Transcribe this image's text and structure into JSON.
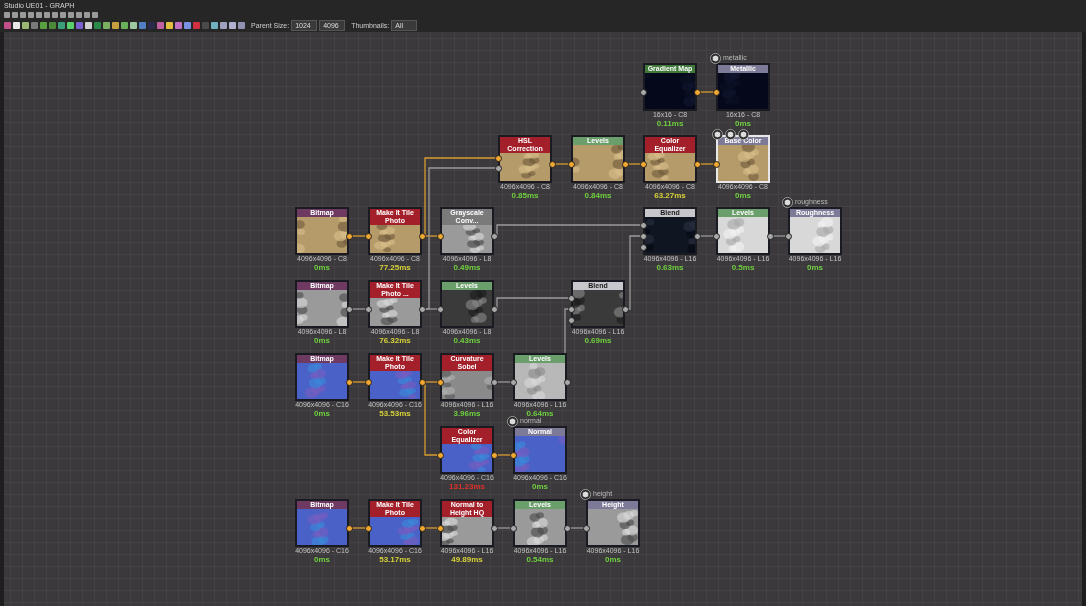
{
  "window": {
    "title": "Studio UE01 - GRAPH"
  },
  "toolbar": {
    "fields": [
      {
        "label": "Parent Size:",
        "value": "1024"
      },
      {
        "value": "4096"
      },
      {
        "label": "Thumbnails:",
        "value": "All"
      }
    ]
  },
  "graph": {
    "nodes": [
      {
        "title": "Gradient Map",
        "color": "#3f7a3a",
        "size": "16x16 - C8",
        "time": {
          "text": "0.11ms",
          "color": "#6fcf3f"
        },
        "selected": false
      },
      {
        "title": "Metallic",
        "color": "#7c7a96",
        "size": "16x16 - C8",
        "time": {
          "text": "0ms",
          "color": "#6fcf3f"
        },
        "selected": false,
        "output_label": "metallic"
      },
      {
        "title": "HSL Correction",
        "color": "#a3202a",
        "size": "4096x4096 - C8",
        "time": {
          "text": "0.85ms",
          "color": "#6fcf3f"
        },
        "selected": false
      },
      {
        "title": "Levels",
        "color": "#6a9e6a",
        "size": "4096x4096 - C8",
        "time": {
          "text": "0.84ms",
          "color": "#6fcf3f"
        },
        "selected": false
      },
      {
        "title": "Color Equalizer",
        "color": "#a3202a",
        "size": "4096x4096 - C8",
        "time": {
          "text": "63.27ms",
          "color": "#d6d23a"
        },
        "selected": false
      },
      {
        "title": "Base Color",
        "color": "#7c7a96",
        "size": "4096x4096 - C8",
        "time": {
          "text": "0ms",
          "color": "#6fcf3f"
        },
        "selected": true
      },
      {
        "title": "Bitmap",
        "color": "#6e3a62",
        "size": "4096x4096 - C8",
        "time": {
          "text": "0ms",
          "color": "#6fcf3f"
        },
        "selected": false
      },
      {
        "title": "Make It Tile Photo",
        "color": "#a3202a",
        "size": "4096x4096 - C8",
        "time": {
          "text": "77.25ms",
          "color": "#d6d23a"
        },
        "selected": false
      },
      {
        "title": "Grayscale Conv...",
        "color": "#7a7a7a",
        "size": "4096x4096 - L8",
        "time": {
          "text": "0.49ms",
          "color": "#6fcf3f"
        },
        "selected": false
      },
      {
        "title": "Blend",
        "color": "#c8c8cc",
        "size": "4096x4096 - L16",
        "time": {
          "text": "0.63ms",
          "color": "#6fcf3f"
        },
        "selected": false
      },
      {
        "title": "Levels",
        "color": "#6a9e6a",
        "size": "4096x4096 - L16",
        "time": {
          "text": "0.5ms",
          "color": "#6fcf3f"
        },
        "selected": false
      },
      {
        "title": "Roughness",
        "color": "#7c7a96",
        "size": "4096x4096 - L16",
        "time": {
          "text": "0ms",
          "color": "#6fcf3f"
        },
        "selected": false,
        "output_label": "roughness"
      },
      {
        "title": "Bitmap",
        "color": "#6e3a62",
        "size": "4096x4096 - L8",
        "time": {
          "text": "0ms",
          "color": "#6fcf3f"
        },
        "selected": false
      },
      {
        "title": "Make It Tile Photo ...",
        "color": "#a3202a",
        "size": "4096x4096 - L8",
        "time": {
          "text": "76.32ms",
          "color": "#d6d23a"
        },
        "selected": false
      },
      {
        "title": "Levels",
        "color": "#6a9e6a",
        "size": "4096x4096 - L8",
        "time": {
          "text": "0.43ms",
          "color": "#6fcf3f"
        },
        "selected": false
      },
      {
        "title": "Blend",
        "color": "#c8c8cc",
        "size": "4096x4096 - L16",
        "time": {
          "text": "0.69ms",
          "color": "#6fcf3f"
        },
        "selected": false
      },
      {
        "title": "Bitmap",
        "color": "#6e3a62",
        "size": "4096x4096 - C16",
        "time": {
          "text": "0ms",
          "color": "#6fcf3f"
        },
        "selected": false
      },
      {
        "title": "Make It Tile Photo",
        "color": "#a3202a",
        "size": "4096x4096 - C16",
        "time": {
          "text": "53.53ms",
          "color": "#d6d23a"
        },
        "selected": false
      },
      {
        "title": "Curvature Sobel",
        "color": "#a3202a",
        "size": "4096x4096 - L16",
        "time": {
          "text": "3.96ms",
          "color": "#6fcf3f"
        },
        "selected": false
      },
      {
        "title": "Levels",
        "color": "#6a9e6a",
        "size": "4096x4096 - L16",
        "time": {
          "text": "0.64ms",
          "color": "#6fcf3f"
        },
        "selected": false
      },
      {
        "title": "Color Equalizer",
        "color": "#a3202a",
        "size": "4096x4096 - C16",
        "time": {
          "text": "131.23ms",
          "color": "#e0302a"
        },
        "selected": false
      },
      {
        "title": "Normal",
        "color": "#7c7a96",
        "size": "4096x4096 - C16",
        "time": {
          "text": "0ms",
          "color": "#6fcf3f"
        },
        "selected": false,
        "output_label": "normal"
      },
      {
        "title": "Bitmap",
        "color": "#6e3a62",
        "size": "4096x4096 - C16",
        "time": {
          "text": "0ms",
          "color": "#6fcf3f"
        },
        "selected": false
      },
      {
        "title": "Make It Tile Photo",
        "color": "#a3202a",
        "size": "4096x4096 - C16",
        "time": {
          "text": "53.17ms",
          "color": "#d6d23a"
        },
        "selected": false
      },
      {
        "title": "Normal to Height HQ",
        "color": "#a3202a",
        "size": "4096x4096 - L16",
        "time": {
          "text": "49.89ms",
          "color": "#d6d23a"
        },
        "selected": false
      },
      {
        "title": "Levels",
        "color": "#6a9e6a",
        "size": "4096x4096 - L16",
        "time": {
          "text": "0.54ms",
          "color": "#6fcf3f"
        },
        "selected": false
      },
      {
        "title": "Height",
        "color": "#7c7a96",
        "size": "4096x4096 - L16",
        "time": {
          "text": "0ms",
          "color": "#6fcf3f"
        },
        "selected": false,
        "output_label": "height"
      }
    ]
  }
}
